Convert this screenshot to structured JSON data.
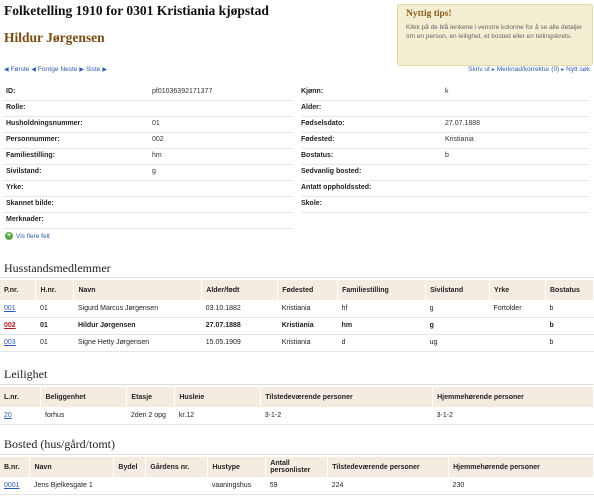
{
  "header": {
    "title": "Folketelling 1910 for 0301 Kristiania kjøpstad",
    "person_name": "Hildur Jørgensen"
  },
  "tips": {
    "title": "Nyttig tips!",
    "text": "Klikk på de blå lenkene i venstre kolonne for å se alle detaljer om en person, en leilighet, et bosted eller en tellingskrets."
  },
  "nav": {
    "first": "Første",
    "prev": "Forrige",
    "next": "Neste",
    "last": "Siste",
    "print": "Skriv ut",
    "comment": "Merknad/korrektur (0)",
    "new_search": "Nytt søk"
  },
  "fields_left": [
    {
      "label": "ID:",
      "value": "pf01036392171377"
    },
    {
      "label": "Rolle:",
      "value": ""
    },
    {
      "label": "Husholdningsnummer:",
      "value": "01"
    },
    {
      "label": "Personnummer:",
      "value": "002"
    },
    {
      "label": "Familiestilling:",
      "value": "hm"
    },
    {
      "label": "Sivilstand:",
      "value": "g"
    },
    {
      "label": "Yrke:",
      "value": ""
    },
    {
      "label": "Skannet bilde:",
      "value": ""
    },
    {
      "label": "Merknader:",
      "value": ""
    }
  ],
  "fields_right": [
    {
      "label": "Kjønn:",
      "value": "k"
    },
    {
      "label": "Alder:",
      "value": ""
    },
    {
      "label": "Fødselsdato:",
      "value": "27.07.1888"
    },
    {
      "label": "Fødested:",
      "value": "Kristiania"
    },
    {
      "label": "Bostatus:",
      "value": "b"
    },
    {
      "label": "Sedvanlig bosted:",
      "value": ""
    },
    {
      "label": "Antatt oppholdssted:",
      "value": ""
    },
    {
      "label": "Skole:",
      "value": ""
    }
  ],
  "show_more": "Vis flere felt",
  "household": {
    "heading": "Husstandsmedlemmer",
    "columns": [
      "P.nr.",
      "H.nr.",
      "Navn",
      "Alder/født",
      "Fødested",
      "Familiestilling",
      "Sivilstand",
      "Yrke",
      "Bostatus"
    ],
    "rows": [
      [
        "001",
        "01",
        "Sigurd Marcus Jørgensen",
        "03.10.1882",
        "Kristiania",
        "hf",
        "g",
        "Fortolder",
        "b"
      ],
      [
        "002",
        "01",
        "Hildur Jørgensen",
        "27.07.1888",
        "Kristiania",
        "hm",
        "g",
        "",
        "b"
      ],
      [
        "003",
        "01",
        "Signe Hetty Jørgensen",
        "15.05.1909",
        "Kristiania",
        "d",
        "ug",
        "",
        "b"
      ]
    ]
  },
  "apartment": {
    "heading": "Leilighet",
    "columns": [
      "L.nr.",
      "Beliggenhet",
      "Etasje",
      "Husleie",
      "Tilstedeværende personer",
      "Hjemmehørende personer"
    ],
    "rows": [
      [
        "20",
        "forhus",
        "2den 2 opg",
        "kr.12",
        "3-1-2",
        "3-1-2"
      ]
    ]
  },
  "residence": {
    "heading": "Bosted (hus/gård/tomt)",
    "columns": [
      "B.nr.",
      "Navn",
      "Bydel",
      "Gårdens nr.",
      "Hustype",
      "Antall personlister",
      "Tilstedeværende personer",
      "Hjemmehørende personer"
    ],
    "rows": [
      [
        "0001",
        "Jens Bjelkesgate 1",
        "",
        "",
        "vaaningshus",
        "59",
        "224",
        "230"
      ]
    ]
  }
}
